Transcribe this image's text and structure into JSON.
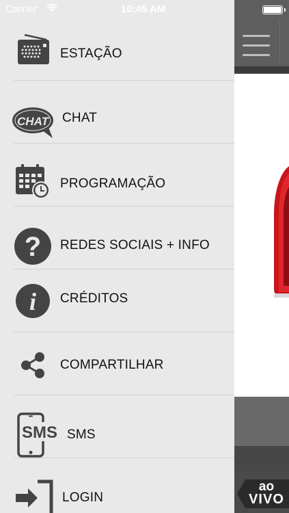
{
  "status_bar": {
    "carrier": "Carrier",
    "time": "10:45 AM"
  },
  "menu": {
    "items": [
      {
        "label": "ESTAÇÃO",
        "icon": "radio-icon"
      },
      {
        "label": "CHAT",
        "icon": "chat-bubble-icon"
      },
      {
        "label": "PROGRAMAÇÃO",
        "icon": "calendar-clock-icon"
      },
      {
        "label": "REDES SOCIAIS + INFO",
        "icon": "question-icon"
      },
      {
        "label": "CRÉDITOS",
        "icon": "info-icon"
      },
      {
        "label": "COMPARTILHAR",
        "icon": "share-icon"
      },
      {
        "label": "SMS",
        "icon": "sms-phone-icon"
      },
      {
        "label": "LOGIN",
        "icon": "login-arrow-icon"
      }
    ]
  },
  "icon_text": {
    "chat": "CHAT",
    "sms": "SMS",
    "question": "?",
    "info": "i"
  },
  "live_badge": {
    "line1": "ao",
    "line2": "VIVO"
  },
  "colors": {
    "drawer_background": "#e9e9e9",
    "icon_gray": "#444444",
    "app_dark_gray": "#595959",
    "logo_red": "#c8151b"
  }
}
